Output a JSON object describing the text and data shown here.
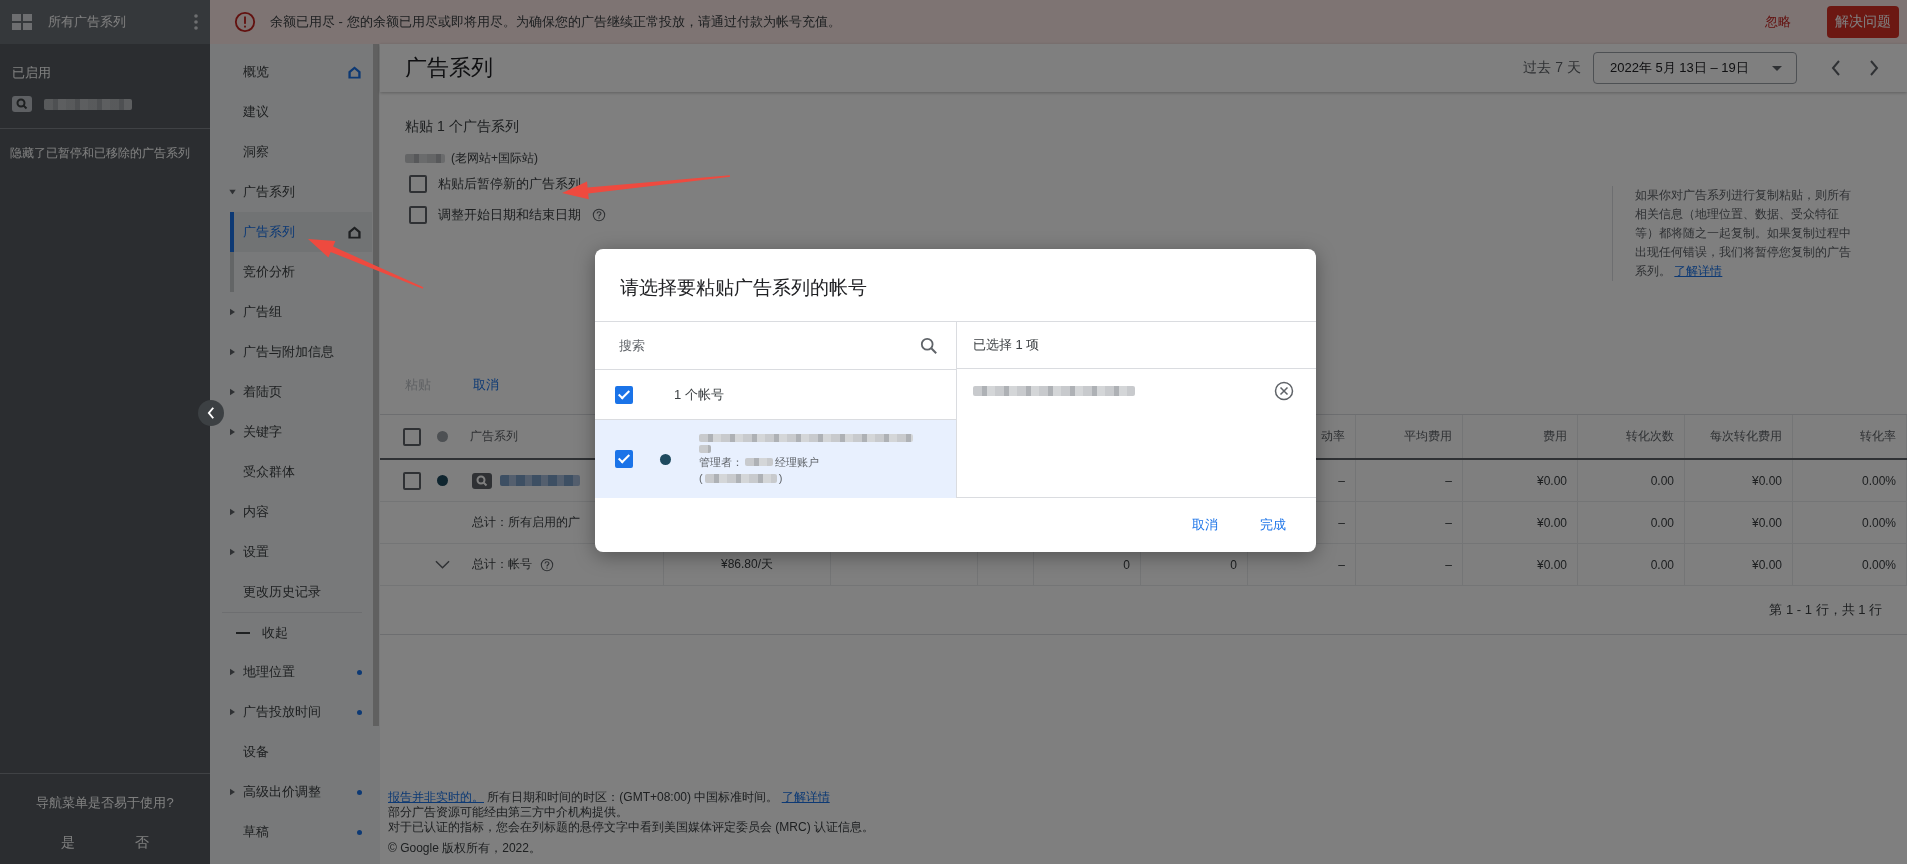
{
  "sidebar": {
    "title": "所有广告系列",
    "section_label": "已启用",
    "hidden_note": "隐藏了已暂停和已移除的广告系列",
    "feedback": {
      "question": "导航菜单是否易于使用?",
      "options": [
        "是",
        "否"
      ]
    }
  },
  "banner": {
    "message": "余额已用尽 - 您的余额已用尽或即将用尽。为确保您的广告继续正常投放，请通过付款为帐号充值。",
    "dismiss": "忽略",
    "action": "解决问题"
  },
  "nav": {
    "items": [
      {
        "label": "概览",
        "selected": false,
        "home": true
      },
      {
        "label": "建议",
        "selected": false
      },
      {
        "label": "洞察",
        "selected": false
      },
      {
        "label": "广告系列",
        "selected": false,
        "expanded": true,
        "children": [
          {
            "label": "广告系列",
            "selected": true,
            "home": true
          },
          {
            "label": "竞价分析",
            "selected": false
          }
        ]
      },
      {
        "label": "广告组",
        "selected": false,
        "expanded": false
      },
      {
        "label": "广告与附加信息",
        "selected": false,
        "expanded": false
      },
      {
        "label": "着陆页",
        "selected": false,
        "expanded": false
      },
      {
        "label": "关键字",
        "selected": false,
        "expanded": false
      },
      {
        "label": "受众群体",
        "selected": false
      },
      {
        "label": "内容",
        "selected": false,
        "expanded": false
      },
      {
        "label": "设置",
        "selected": false,
        "expanded": false
      },
      {
        "label": "更改历史记录",
        "selected": false
      },
      {
        "label": "收起",
        "kind": "collapse",
        "selected": false
      },
      {
        "label": "地理位置",
        "selected": false,
        "expanded": false,
        "dot": true
      },
      {
        "label": "广告投放时间",
        "selected": false,
        "expanded": false,
        "dot": true
      },
      {
        "label": "设备",
        "selected": false
      },
      {
        "label": "高级出价调整",
        "selected": false,
        "expanded": false,
        "dot": true
      },
      {
        "label": "草稿",
        "selected": false,
        "dot": true
      }
    ]
  },
  "header": {
    "title": "广告系列",
    "range_label": "过去 7 天",
    "date_range": "2022年 5月 13日 – 19日"
  },
  "paste_panel": {
    "title": "粘贴 1 个广告系列",
    "account_suffix": "(老网站+国际站)",
    "options": [
      {
        "label": "粘贴后暂停新的广告系列",
        "checked": false
      },
      {
        "label": "调整开始日期和结束日期",
        "checked": false,
        "help": true
      }
    ],
    "note": "如果你对广告系列进行复制粘贴，则所有相关信息（地理位置、数据、受众特征等）都将随之一起复制。如果复制过程中出现任何错误，我们将暂停您复制的广告系列。",
    "note_link": "了解详情",
    "buttons": [
      {
        "label": "粘贴",
        "disabled": true
      },
      {
        "label": "取消",
        "disabled": false
      }
    ]
  },
  "table": {
    "select_all_checked": false,
    "columns": [
      "广告系列",
      "",
      "",
      "",
      "",
      "",
      "动率",
      "平均费用",
      "费用",
      "转化次数",
      "每次转化费用",
      "转化率"
    ],
    "rows": [
      {
        "kind": "campaign",
        "checked": false,
        "cells": [
          "",
          "",
          "",
          "",
          "",
          "",
          "–",
          "–",
          "¥0.00",
          "0.00",
          "¥0.00",
          "0.00%"
        ]
      },
      {
        "kind": "total",
        "cells": [
          "总计：所有启用的广",
          "",
          "",
          "",
          "",
          "",
          "–",
          "–",
          "¥0.00",
          "0.00",
          "¥0.00",
          "0.00%"
        ]
      },
      {
        "kind": "account_total",
        "expanded": false,
        "cells": [
          "总计：帐号",
          "¥86.80/天",
          "",
          "",
          "0",
          "0",
          "–",
          "–",
          "¥0.00",
          "0.00",
          "¥0.00",
          "0.00%"
        ]
      }
    ]
  },
  "pagination": "第 1 - 1 行，共 1 行",
  "footer": {
    "link": "报告并非实时的。",
    "timezone": "所有日期和时间的时区：(GMT+08:00) 中国标准时间。",
    "more_link": "了解详情",
    "lines": [
      "部分广告资源可能经由第三方中介机构提供。",
      "对于已认证的指标，您会在列标题的悬停文字中看到美国媒体评定委员会 (MRC) 认证信息。",
      "© Google 版权所有，2022。"
    ]
  },
  "dialog": {
    "title": "请选择要粘贴广告系列的帐号",
    "search_placeholder": "搜索",
    "list_header": {
      "label": "1 个帐号",
      "checked": true
    },
    "accounts": [
      {
        "checked": true,
        "selected": true,
        "manager_prefix": "管理者：",
        "manager_suffix": "经理账户",
        "id_open": "(",
        "id_close": ")"
      }
    ],
    "selected_label": "已选择 1 项",
    "buttons": [
      "取消",
      "完成"
    ]
  }
}
